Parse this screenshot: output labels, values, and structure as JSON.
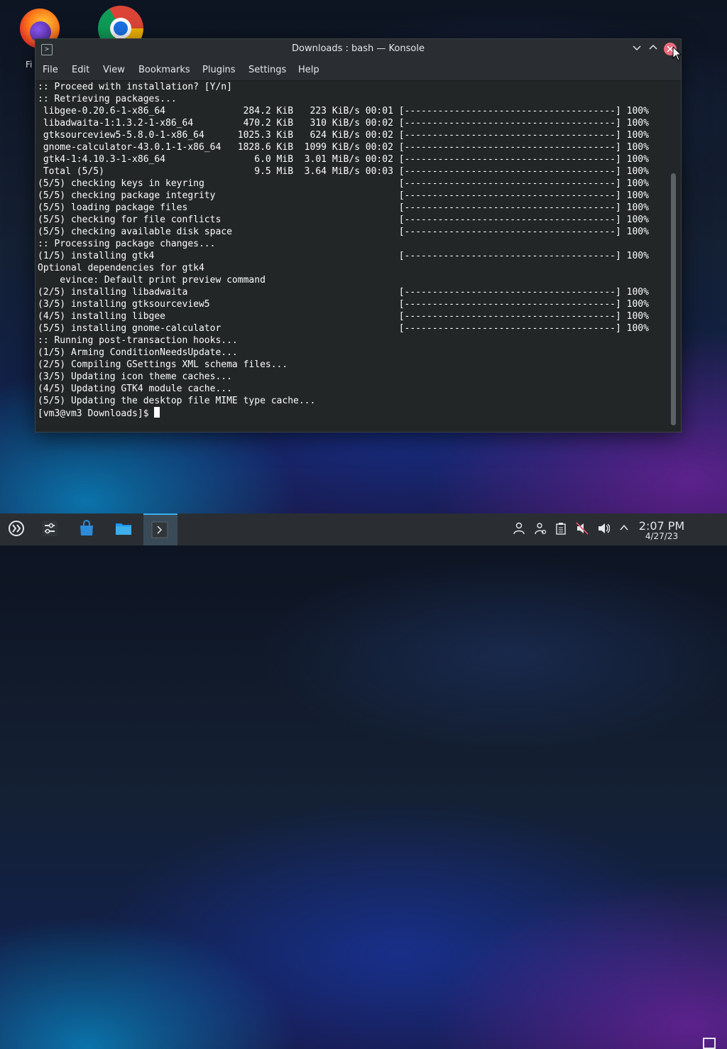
{
  "desktop": {
    "icons": [
      {
        "label": "Fi",
        "icon": "firefox-icon"
      },
      {
        "label": "",
        "icon": "chrome-icon"
      }
    ]
  },
  "window": {
    "title": "Downloads : bash — Konsole",
    "menu": [
      "File",
      "Edit",
      "View",
      "Bookmarks",
      "Plugins",
      "Settings",
      "Help"
    ]
  },
  "terminal": {
    "lines": [
      ":: Proceed with installation? [Y/n]",
      ":: Retrieving packages...",
      " libgee-0.20.6-1-x86_64              284.2 KiB   223 KiB/s 00:01 [--------------------------------------] 100%",
      " libadwaita-1:1.3.2-1-x86_64         470.2 KiB   310 KiB/s 00:02 [--------------------------------------] 100%",
      " gtksourceview5-5.8.0-1-x86_64      1025.3 KiB   624 KiB/s 00:02 [--------------------------------------] 100%",
      " gnome-calculator-43.0.1-1-x86_64   1828.6 KiB  1099 KiB/s 00:02 [--------------------------------------] 100%",
      " gtk4-1:4.10.3-1-x86_64                6.0 MiB  3.01 MiB/s 00:02 [--------------------------------------] 100%",
      " Total (5/5)                           9.5 MiB  3.64 MiB/s 00:03 [--------------------------------------] 100%",
      "(5/5) checking keys in keyring                                   [--------------------------------------] 100%",
      "(5/5) checking package integrity                                 [--------------------------------------] 100%",
      "(5/5) loading package files                                      [--------------------------------------] 100%",
      "(5/5) checking for file conflicts                                [--------------------------------------] 100%",
      "(5/5) checking available disk space                              [--------------------------------------] 100%",
      ":: Processing package changes...",
      "(1/5) installing gtk4                                            [--------------------------------------] 100%",
      "Optional dependencies for gtk4",
      "    evince: Default print preview command",
      "(2/5) installing libadwaita                                      [--------------------------------------] 100%",
      "(3/5) installing gtksourceview5                                  [--------------------------------------] 100%",
      "(4/5) installing libgee                                          [--------------------------------------] 100%",
      "(5/5) installing gnome-calculator                                [--------------------------------------] 100%",
      ":: Running post-transaction hooks...",
      "(1/5) Arming ConditionNeedsUpdate...",
      "(2/5) Compiling GSettings XML schema files...",
      "(3/5) Updating icon theme caches...",
      "(4/5) Updating GTK4 module cache...",
      "(5/5) Updating the desktop file MIME type cache..."
    ],
    "prompt": "[vm3@vm3 Downloads]$ "
  },
  "taskbar": {
    "time": "2:07 PM",
    "date": "4/27/23"
  }
}
